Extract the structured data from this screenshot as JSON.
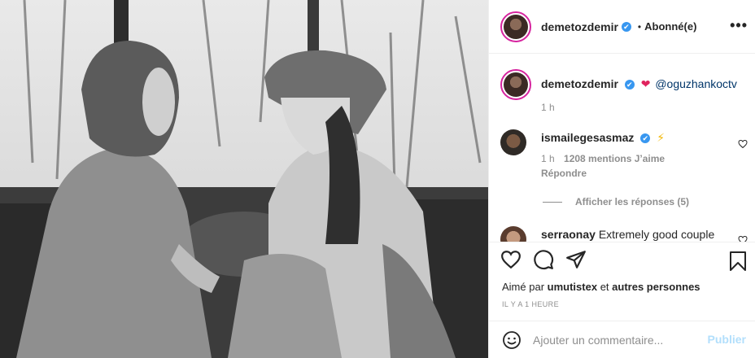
{
  "post": {
    "author": {
      "username": "demetozdemir",
      "verified_badge": "✔",
      "separator": "•",
      "follow_status": "Abonné(e)"
    },
    "more_label": "•••",
    "caption": {
      "username": "demetozdemir",
      "emoji": "❤",
      "mention": "@oguzhankoctv",
      "time": "1 h"
    },
    "comments": [
      {
        "username": "ismailegesasmaz",
        "emoji": "⚡",
        "time": "1 h",
        "likes": "1208 mentions J’aime",
        "reply_label": "Répondre"
      },
      {
        "username": "serraonay",
        "text": "Extremely good couple"
      }
    ],
    "view_replies": "Afficher les réponses (5)",
    "liked_by": {
      "prefix": "Aimé par",
      "user": "umutistex",
      "conjunction": "et",
      "others": "autres personnes"
    },
    "time_ago": "IL Y A 1 HEURE",
    "comment_input": {
      "placeholder": "Ajouter un commentaire..."
    },
    "publish_label": "Publier",
    "icons": [
      "like-heart-icon",
      "comment-bubble-icon",
      "share-paper-plane-icon",
      "bookmark-icon",
      "emoji-smiley-icon",
      "more-dots-icon"
    ],
    "colors": {
      "verified": "#3897f0",
      "heart_emoji": "#e0245e",
      "mention": "#003569",
      "muted": "#8e8e8e",
      "publish_disabled": "#b2dffc"
    }
  }
}
